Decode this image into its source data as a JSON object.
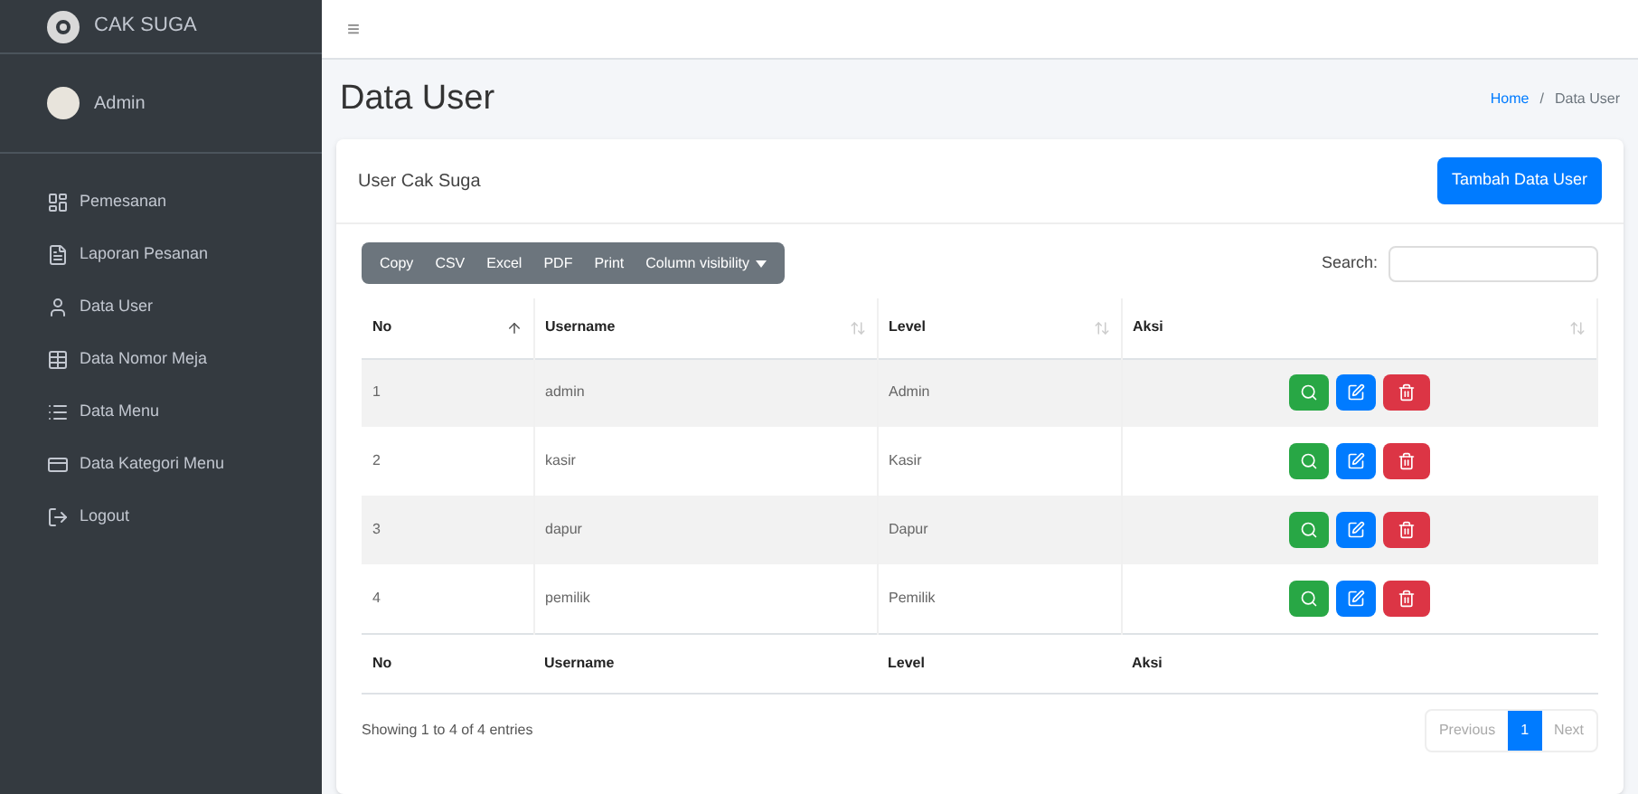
{
  "brand": {
    "name": "CAK SUGA"
  },
  "user": {
    "name": "Admin"
  },
  "sidebar": {
    "items": [
      {
        "label": "Pemesanan"
      },
      {
        "label": "Laporan Pesanan"
      },
      {
        "label": "Data User"
      },
      {
        "label": "Data Nomor Meja"
      },
      {
        "label": "Data Menu"
      },
      {
        "label": "Data Kategori Menu"
      },
      {
        "label": "Logout"
      }
    ]
  },
  "topbar": {
    "menu": "≡"
  },
  "page": {
    "title": "Data User",
    "breadcrumb": [
      {
        "label": "Home",
        "link": true
      },
      {
        "label": "/",
        "kind": "separator",
        "link": false
      },
      {
        "label": "Data User",
        "link": false
      }
    ]
  },
  "card": {
    "title": "User Cak Suga",
    "add_button": "Tambah Data User"
  },
  "export_buttons": [
    "Copy",
    "CSV",
    "Excel",
    "PDF",
    "Print",
    "Column visibility"
  ],
  "search": {
    "label": "Search:"
  },
  "table": {
    "columns": [
      {
        "label": "No",
        "sorted": true
      },
      {
        "label": "Username",
        "sorted": false
      },
      {
        "label": "Level",
        "sorted": false
      },
      {
        "label": "Aksi",
        "sorted": false
      }
    ],
    "rows": [
      [
        "1",
        "admin",
        "Admin"
      ],
      [
        "2",
        "kasir",
        "Kasir"
      ],
      [
        "3",
        "dapur",
        "Dapur"
      ],
      [
        "4",
        "pemilik",
        "Pemilik"
      ]
    ],
    "footer": [
      "No",
      "Username",
      "Level",
      "Aksi"
    ]
  },
  "info": "Showing 1 to 4 of 4 entries",
  "pagination": [
    {
      "label": "Previous",
      "selected": false
    },
    {
      "label": "1",
      "selected": true
    },
    {
      "label": "Next",
      "selected": false
    }
  ]
}
